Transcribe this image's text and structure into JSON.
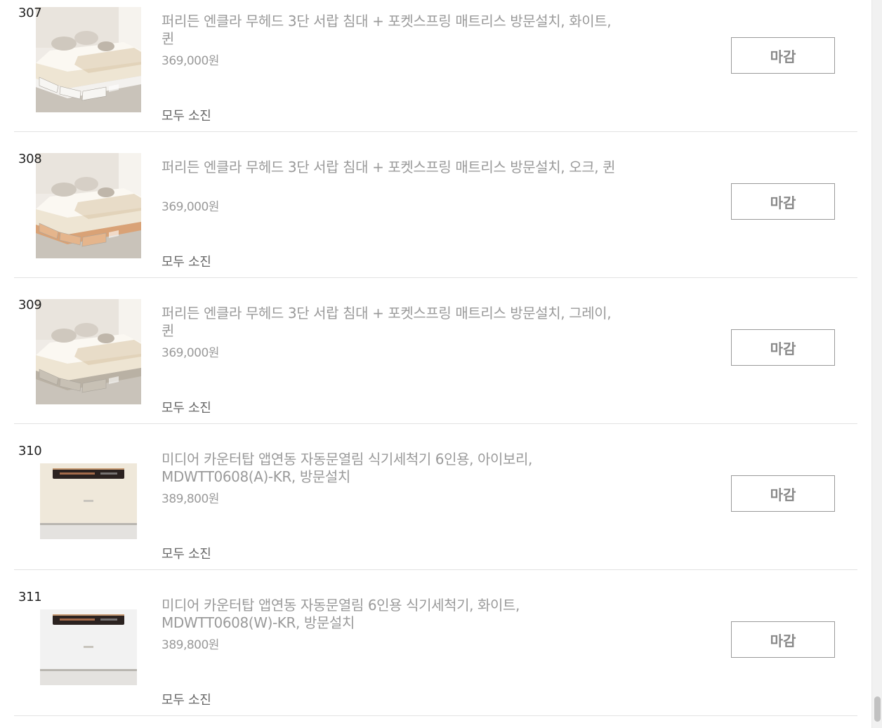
{
  "products": [
    {
      "rank": "307",
      "title": "퍼리든 엔클라 무헤드 3단 서랍 침대 + 포켓스프링 매트리스 방문설치, 화이트, 퀸",
      "price": "369,000원",
      "status": "모두 소진",
      "button_label": "마감",
      "image_kind": "bed",
      "frame_color": "#f3f1ee",
      "drawer_color": "#f7f6f3"
    },
    {
      "rank": "308",
      "title": "퍼리든 엔클라 무헤드 3단 서랍 침대 + 포켓스프링 매트리스 방문설치, 오크, 퀸",
      "price": "369,000원",
      "status": "모두 소진",
      "button_label": "마감",
      "image_kind": "bed",
      "frame_color": "#d9a276",
      "drawer_color": "#e5b58c"
    },
    {
      "rank": "309",
      "title": "퍼리든 엔클라 무헤드 3단 서랍 침대 + 포켓스프링 매트리스 방문설치, 그레이, 퀸",
      "price": "369,000원",
      "status": "모두 소진",
      "button_label": "마감",
      "image_kind": "bed",
      "frame_color": "#b9b1a4",
      "drawer_color": "#c8c1b5"
    },
    {
      "rank": "310",
      "title": "미디어 카운터탑 앱연동 자동문열림 식기세척기 6인용, 아이보리, MDWTT0608(A)-KR, 방문설치",
      "price": "389,800원",
      "status": "모두 소진",
      "button_label": "마감",
      "image_kind": "dishwasher",
      "body_color": "#efe8da",
      "panel_color": "#2b2220"
    },
    {
      "rank": "311",
      "title": "미디어 카운터탑 앱연동 자동문열림 6인용 식기세척기, 화이트, MDWTT0608(W)-KR, 방문설치",
      "price": "389,800원",
      "status": "모두 소진",
      "button_label": "마감",
      "image_kind": "dishwasher",
      "body_color": "#f2f2f2",
      "panel_color": "#2b2220"
    }
  ]
}
